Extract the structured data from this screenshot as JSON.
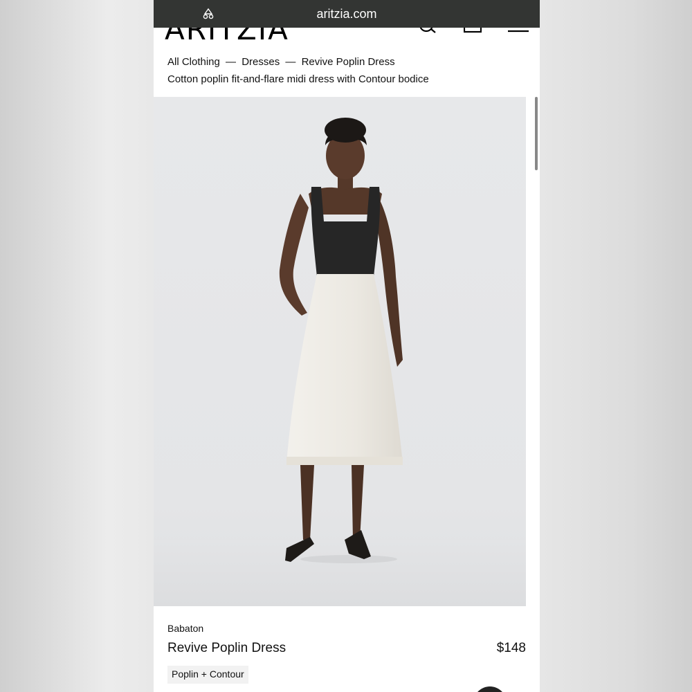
{
  "browser": {
    "url": "aritzia.com",
    "icon": "reader-icon"
  },
  "site": {
    "logo": "ARITZIA",
    "icons": [
      "search-icon",
      "bag-icon",
      "menu-icon"
    ]
  },
  "breadcrumb": {
    "items": [
      "All Clothing",
      "Dresses",
      "Revive Poplin Dress"
    ],
    "separator": "—"
  },
  "product": {
    "subtitle": "Cotton poplin fit-and-flare midi dress with Contour bodice",
    "brand": "Babaton",
    "name": "Revive Poplin Dress",
    "price": "$148",
    "tag": "Poplin + Contour",
    "image": "model-photo"
  },
  "colors": {
    "url_bar": "#333533",
    "image_bg": "#e6e7e9"
  }
}
